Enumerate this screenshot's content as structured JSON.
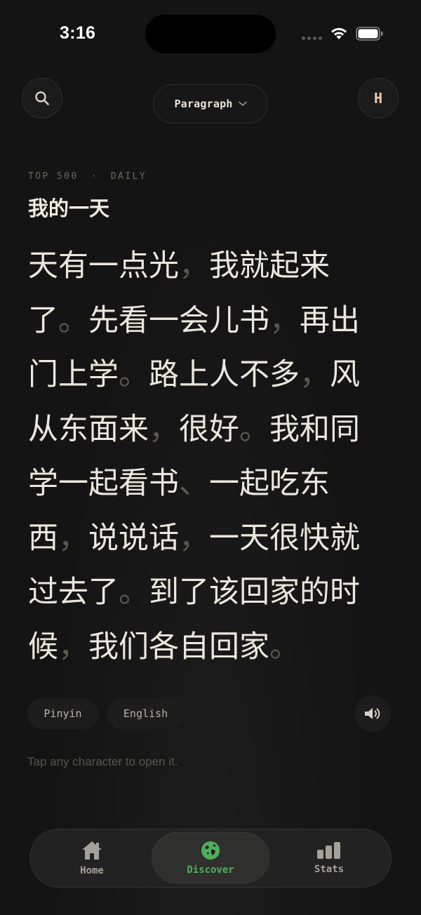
{
  "status_bar": {
    "time": "3:16"
  },
  "header": {
    "search_icon": "search-icon",
    "mode_selector": {
      "label": "Paragraph",
      "icon": "chevron-down-icon"
    },
    "profile_initial": "H"
  },
  "reading": {
    "meta": {
      "level": "TOP 500",
      "separator": "·",
      "category": "DAILY"
    },
    "title": "我的一天",
    "lines": [
      [
        {
          "t": "天有一点光"
        },
        {
          "t": "，",
          "p": true
        },
        {
          "t": "我就起来"
        }
      ],
      [
        {
          "t": "了"
        },
        {
          "t": "。",
          "p": true
        },
        {
          "t": "先看一会儿书"
        },
        {
          "t": "，",
          "p": true
        },
        {
          "t": "再出"
        }
      ],
      [
        {
          "t": "门上学"
        },
        {
          "t": "。",
          "p": true
        },
        {
          "t": "路上人不多"
        },
        {
          "t": "，",
          "p": true
        },
        {
          "t": "风"
        }
      ],
      [
        {
          "t": "从东面来"
        },
        {
          "t": "，",
          "p": true
        },
        {
          "t": "很好"
        },
        {
          "t": "。",
          "p": true
        },
        {
          "t": "我和同"
        }
      ],
      [
        {
          "t": "学一起看书"
        },
        {
          "t": "、",
          "p": true
        },
        {
          "t": "一起吃东"
        }
      ],
      [
        {
          "t": "西"
        },
        {
          "t": "，",
          "p": true
        },
        {
          "t": "说说话"
        },
        {
          "t": "，",
          "p": true
        },
        {
          "t": "一天很快就"
        }
      ],
      [
        {
          "t": "过去了"
        },
        {
          "t": "。",
          "p": true
        },
        {
          "t": "到了该回家的时"
        }
      ],
      [
        {
          "t": "候"
        },
        {
          "t": "，",
          "p": true
        },
        {
          "t": "我们各自回家"
        },
        {
          "t": "。",
          "p": true
        }
      ]
    ],
    "toggles": {
      "pinyin": "Pinyin",
      "english": "English"
    },
    "audio_icon": "speaker-icon",
    "hint": "Tap any character to open it."
  },
  "tabbar": {
    "items": [
      {
        "label": "Home",
        "icon": "home-icon"
      },
      {
        "label": "Discover",
        "icon": "globe-icon",
        "active": true
      },
      {
        "label": "Stats",
        "icon": "bar-chart-icon"
      }
    ]
  },
  "colors": {
    "background": "#141414",
    "text": "#ece7dd",
    "muted": "#6c6860",
    "accent_active": "#4fae5a",
    "profile_initial": "#f2c9a6"
  }
}
